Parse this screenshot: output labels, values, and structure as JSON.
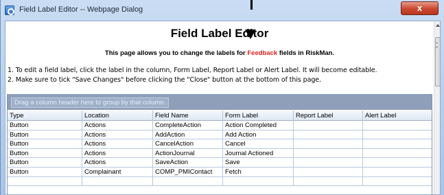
{
  "window": {
    "title": "Field Label Editor -- Webpage Dialog",
    "close_label": "x"
  },
  "page": {
    "title": "Field Label Editor",
    "subtitle_before": "This page allows you to change the labels for ",
    "subtitle_highlight": "Feedback",
    "subtitle_after": " fields in RiskMan.",
    "instruction_1": "1.  To edit a field label, click the label in the column, Form Label, Report Label or Alert Label. It will become editable.",
    "instruction_2": "2.  Make sure to tick \"Save Changes\" before clicking the \"Close\" button at the bottom of this page."
  },
  "grid": {
    "group_hint": "Drag a column header here to group by that column.",
    "headers": [
      "Type",
      "Location",
      "Field Name",
      "Form Label",
      "Report Label",
      "Alert Label"
    ],
    "rows": [
      [
        "Button",
        "Actions",
        "CompleteAction",
        "Action Completed",
        "",
        ""
      ],
      [
        "Button",
        "Actions",
        "AddAction",
        "Add Action",
        "",
        ""
      ],
      [
        "Button",
        "Actions",
        "CancelAction",
        "Cancel",
        "",
        ""
      ],
      [
        "Button",
        "Actions",
        "ActionJournal",
        "Journal Actioned",
        "",
        ""
      ],
      [
        "Button",
        "Actions",
        "SaveAction",
        "Save",
        "",
        ""
      ],
      [
        "Button",
        "Complainant",
        "COMP_PMIContact",
        "Fetch",
        "",
        ""
      ]
    ]
  },
  "colors": {
    "accent_red": "#e0201b",
    "group_panel": "#8f9fb9"
  },
  "icons": {
    "window_icon": "ie-icon",
    "close_icon": "close-icon"
  }
}
